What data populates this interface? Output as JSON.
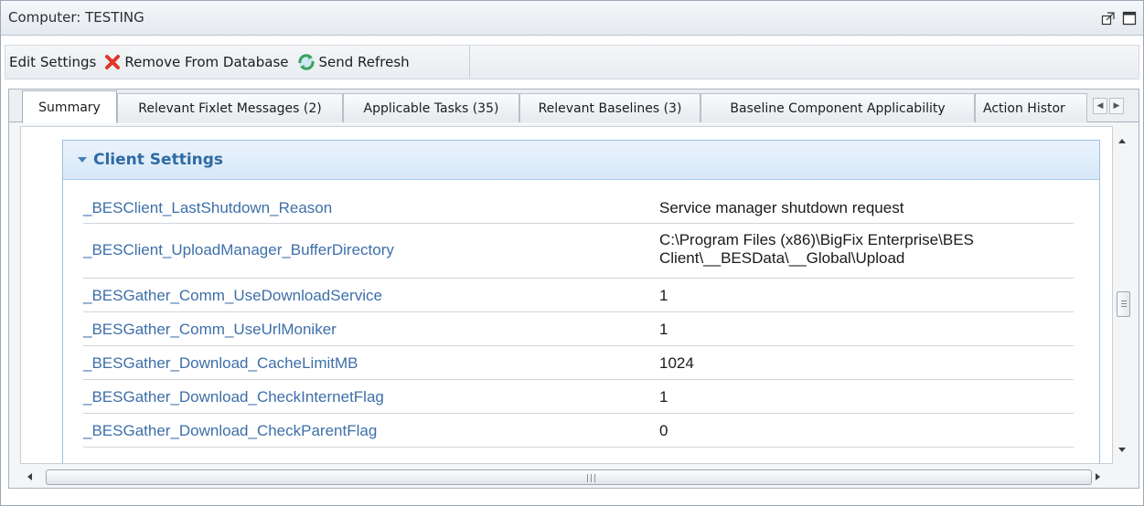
{
  "window": {
    "title": "Computer: TESTING"
  },
  "toolbar": {
    "edit_label": "Edit Settings",
    "remove_label": "Remove From Database",
    "refresh_label": "Send Refresh"
  },
  "tabs": [
    {
      "label": "Summary",
      "active": true
    },
    {
      "label": "Relevant Fixlet Messages (2)"
    },
    {
      "label": "Applicable Tasks (35)"
    },
    {
      "label": "Relevant Baselines (3)"
    },
    {
      "label": "Baseline Component Applicability"
    },
    {
      "label": "Action Histor"
    }
  ],
  "section": {
    "title": "Client Settings",
    "rows": [
      {
        "name": "_BESClient_LastShutdown_Reason",
        "value": "Service manager shutdown request"
      },
      {
        "name": "_BESClient_UploadManager_BufferDirectory",
        "value": "C:\\Program Files (x86)\\BigFix Enterprise\\BES Client\\__BESData\\__Global\\Upload"
      },
      {
        "name": "_BESGather_Comm_UseDownloadService",
        "value": "1"
      },
      {
        "name": "_BESGather_Comm_UseUrlMoniker",
        "value": "1"
      },
      {
        "name": "_BESGather_Download_CacheLimitMB",
        "value": "1024"
      },
      {
        "name": "_BESGather_Download_CheckInternetFlag",
        "value": "1"
      },
      {
        "name": "_BESGather_Download_CheckParentFlag",
        "value": "0"
      }
    ]
  },
  "colors": {
    "link": "#3d6fa8",
    "section_header": "#2f6aa3",
    "remove_icon": "#e2362a",
    "refresh_icon": "#3aa35a"
  },
  "icons": [
    "restore-icon",
    "maximize-icon",
    "remove-x-icon",
    "refresh-icon",
    "tab-scroll-left-icon",
    "tab-scroll-right-icon",
    "collapse-caret-icon"
  ]
}
